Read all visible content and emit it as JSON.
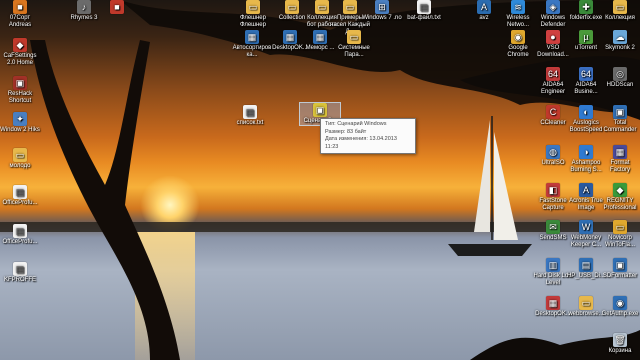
{
  "icons": [
    {
      "id": "c1r0",
      "label": "07Сорт Andreas",
      "color": "#d9761f",
      "glyph": "■"
    },
    {
      "id": "c1r1",
      "label": "CaFSettings 2.0 Home",
      "color": "#c0392b",
      "glyph": "◆"
    },
    {
      "id": "c1r2",
      "label": "ResHack Shortcut",
      "color": "#a23127",
      "glyph": "▣"
    },
    {
      "id": "c1r3",
      "label": "Window 2 Hiks",
      "color": "#4a7fc1",
      "glyph": "✦"
    },
    {
      "id": "c1r4",
      "label": "молодо",
      "color": "#e7b84b",
      "glyph": "▭"
    },
    {
      "id": "c1r5",
      "label": "OfficeProfu...",
      "color": "#f2f2f2",
      "glyph": "▤"
    },
    {
      "id": "c1r6",
      "label": "OfficeProfu...",
      "color": "#f2f2f2",
      "glyph": "▤"
    },
    {
      "id": "c1r7",
      "label": "KFPROFFE",
      "color": "#f2f2f2",
      "glyph": "▤"
    },
    {
      "id": "t1",
      "label": "Rhymes 3",
      "color": "#6b6b6b",
      "glyph": "♪"
    },
    {
      "id": "t2",
      "label": "",
      "color": "#c0392b",
      "glyph": "■"
    },
    {
      "id": "t3",
      "label": "Флешнер Флешнер",
      "color": "#e7b84b",
      "glyph": "▭"
    },
    {
      "id": "t4",
      "label": "Collection",
      "color": "#e7b84b",
      "glyph": "▭"
    },
    {
      "id": "t5",
      "label": "Коллекция бот работа",
      "color": "#e7b84b",
      "glyph": "▭"
    },
    {
      "id": "t6",
      "label": "Примеры насел Каждый Д...",
      "color": "#e7b84b",
      "glyph": "▭"
    },
    {
      "id": "t7",
      "label": "Windows 7 .no",
      "color": "#4a7fc1",
      "glyph": "⊞"
    },
    {
      "id": "t8",
      "label": "bat-файл.txt",
      "color": "#f2f2f2",
      "glyph": "▤"
    },
    {
      "id": "t9",
      "label": "avz",
      "color": "#2b6cb0",
      "glyph": "A"
    },
    {
      "id": "m1",
      "label": "Автосортировка...",
      "color": "#2f6fb5",
      "glyph": "▦"
    },
    {
      "id": "m2",
      "label": "DesktopOK...",
      "color": "#2f6fb5",
      "glyph": "▦"
    },
    {
      "id": "m3",
      "label": "Меморс ...",
      "color": "#2f6fb5",
      "glyph": "▦"
    },
    {
      "id": "m4",
      "label": "Системные Пара...",
      "color": "#e7b84b",
      "glyph": "▭"
    },
    {
      "id": "f1",
      "label": "список.txt",
      "color": "#f2f2f2",
      "glyph": "▤"
    },
    {
      "id": "f2",
      "label": "Сценарий...",
      "color": "#d9c23a",
      "glyph": "▣",
      "selected": true
    },
    {
      "id": "r0a",
      "label": "Wireless Netwo...",
      "color": "#2f8ad9",
      "glyph": "≋"
    },
    {
      "id": "r0b",
      "label": "Windows Defender",
      "color": "#3a77c2",
      "glyph": "◈"
    },
    {
      "id": "r0c",
      "label": "folderfix.exe",
      "color": "#3a8a3a",
      "glyph": "✚"
    },
    {
      "id": "r0d",
      "label": "Коллекция",
      "color": "#e7b84b",
      "glyph": "▭"
    },
    {
      "id": "r1a",
      "label": "Google Chrome",
      "color": "#e0a82e",
      "glyph": "◉"
    },
    {
      "id": "r1b",
      "label": "VSO Download...",
      "color": "#d04040",
      "glyph": "●"
    },
    {
      "id": "r1c",
      "label": "uTorrent",
      "color": "#4a9a3a",
      "glyph": "µ"
    },
    {
      "id": "r1d",
      "label": "Skymonk 2",
      "color": "#6aa7d8",
      "glyph": "☁"
    },
    {
      "id": "r2a",
      "label": "AIDA64 Engineer",
      "color": "#c23a3a",
      "glyph": "64"
    },
    {
      "id": "r2b",
      "label": "AIDA64 Busine...",
      "color": "#3a6ec2",
      "glyph": "64"
    },
    {
      "id": "r2c",
      "label": "HDDScan",
      "color": "#6a6a6a",
      "glyph": "◎"
    },
    {
      "id": "r3a",
      "label": "CCleaner",
      "color": "#c0392b",
      "glyph": "C"
    },
    {
      "id": "r3b",
      "label": "Auslogics BoostSpeed",
      "color": "#2f7ad1",
      "glyph": "◐"
    },
    {
      "id": "r3c",
      "label": "Total Commander",
      "color": "#2f6fb5",
      "glyph": "▣"
    },
    {
      "id": "r4a",
      "label": "UltraISO",
      "color": "#3a77c2",
      "glyph": "◍"
    },
    {
      "id": "r4b",
      "label": "Ashampoo Burning S...",
      "color": "#2f7ad1",
      "glyph": "◑"
    },
    {
      "id": "r4c",
      "label": "Format Factory",
      "color": "#4a4a9a",
      "glyph": "▦"
    },
    {
      "id": "r5a",
      "label": "FastStone Capture",
      "color": "#c23a3a",
      "glyph": "◧"
    },
    {
      "id": "r5b",
      "label": "Acronis True Image",
      "color": "#2a5aa0",
      "glyph": "A"
    },
    {
      "id": "r5c",
      "label": "REGNITY Professional",
      "color": "#3a9a3a",
      "glyph": "◆"
    },
    {
      "id": "r6a",
      "label": "SendSMS",
      "color": "#3a8a3a",
      "glyph": "✉"
    },
    {
      "id": "r6b",
      "label": "WebMoney Keeper C...",
      "color": "#2f6fb5",
      "glyph": "W"
    },
    {
      "id": "r6c",
      "label": "Novicorp WinToFla...",
      "color": "#e0a82e",
      "glyph": "▭"
    },
    {
      "id": "r7a",
      "label": "Hard Disk Low Level",
      "color": "#3a77c2",
      "glyph": "▥"
    },
    {
      "id": "r7b",
      "label": "HP_USB_Di...",
      "color": "#2f6fb5",
      "glyph": "▤"
    },
    {
      "id": "r7c",
      "label": "SDFormatter",
      "color": "#2f6fb5",
      "glyph": "▣"
    },
    {
      "id": "r8a",
      "label": "DesktopOK...",
      "color": "#c23a3a",
      "glyph": "▦"
    },
    {
      "id": "r8b",
      "label": "webbrowse...",
      "color": "#e7b84b",
      "glyph": "▭"
    },
    {
      "id": "r8c",
      "label": "GetAuthp.exe",
      "color": "#2f6fb5",
      "glyph": "◉"
    },
    {
      "id": "r9a",
      "label": "Корзина",
      "color": "#b9c6d3",
      "glyph": "🗑"
    }
  ],
  "tooltip": {
    "type_line": "Тип: Сценарий Windows",
    "size_line": "Размер: 83 байт",
    "date_line": "Дата изменения: 13.04.2013 11:23"
  }
}
